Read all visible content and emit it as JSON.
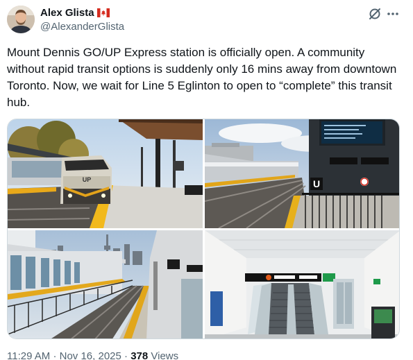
{
  "author": {
    "name": "Alex Glista",
    "handle": "@AlexanderGlista",
    "flag_icon": "canada-flag-icon"
  },
  "icons": {
    "grok": "grok-icon",
    "more": "more-icon"
  },
  "tweet": {
    "text": "Mount Dennis GO/UP Express station is officially open. A community without rapid transit options is suddenly only 16 mins away from downtown Toronto. Now, we wait for Line 5 Eglinton to open to “complete” this transit hub."
  },
  "media": {
    "photo1": {
      "sign": "UP"
    },
    "photo2": {
      "sign": "U"
    },
    "photo4": {
      "sign": ""
    }
  },
  "meta": {
    "time": "11:29 AM",
    "separator": "·",
    "date": "Nov 16, 2025",
    "views_count": "378",
    "views_label": "Views"
  },
  "colors": {
    "text": "#0f1419",
    "secondary": "#536471",
    "border": "#cfd9de",
    "flag_red": "#d52b1e"
  }
}
